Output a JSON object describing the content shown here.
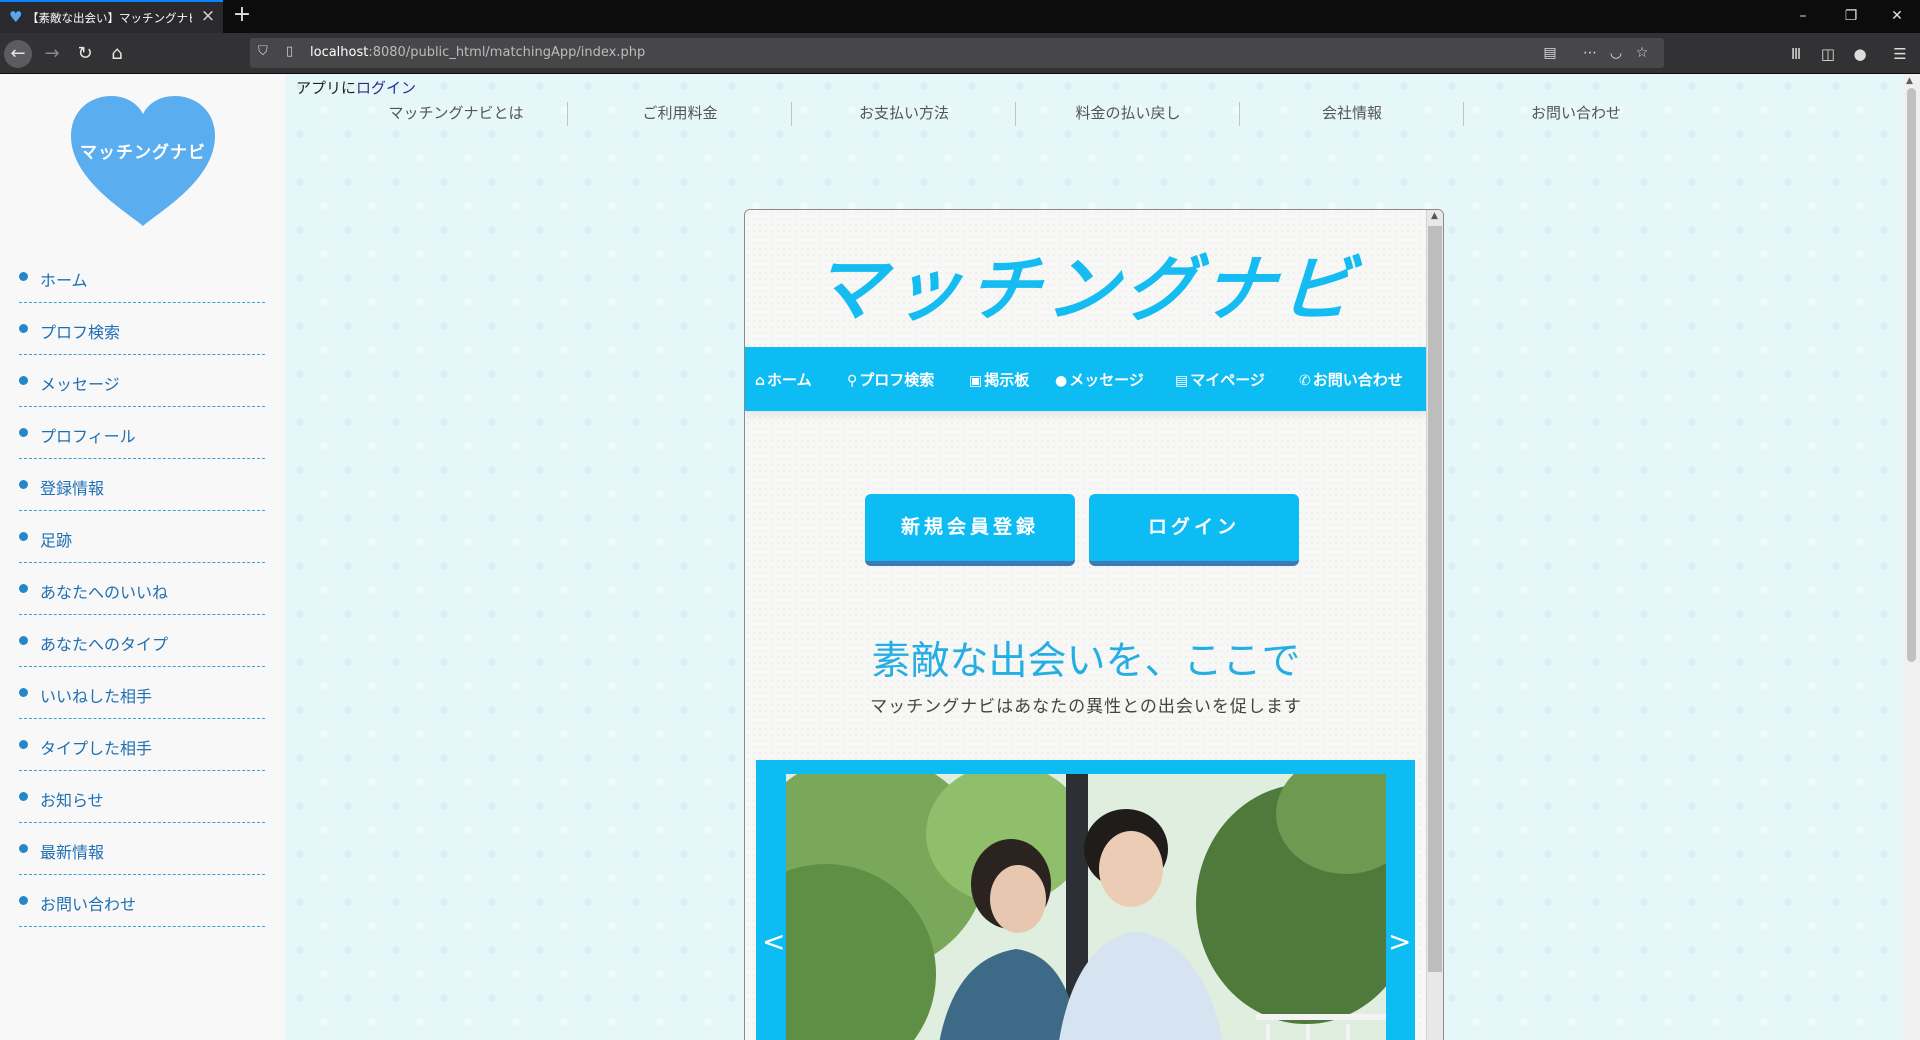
{
  "browser": {
    "tab_title": "【素敵な出会い】マッチングナビ！",
    "url_host": "localhost",
    "url_path": ":8080/public_html/matchingApp/index.php",
    "window_controls": {
      "minimize": "–",
      "restore": "❐",
      "close": "✕"
    }
  },
  "sidebar": {
    "logo_text": "マッチングナビ",
    "logo_color": "#5aaef0",
    "items": [
      {
        "label": "ホーム"
      },
      {
        "label": "プロフ検索"
      },
      {
        "label": "メッセージ"
      },
      {
        "label": "プロフィール"
      },
      {
        "label": "登録情報"
      },
      {
        "label": "足跡"
      },
      {
        "label": "あなたへのいいね"
      },
      {
        "label": "あなたへのタイプ"
      },
      {
        "label": "いいねした相手"
      },
      {
        "label": "タイプした相手"
      },
      {
        "label": "お知らせ"
      },
      {
        "label": "最新情報"
      },
      {
        "label": "お問い合わせ"
      }
    ]
  },
  "top": {
    "login_prefix": "アプリに",
    "login_link": "ログイン",
    "nav": [
      "マッチングナビとは",
      "ご利用料金",
      "お支払い方法",
      "料金の払い戻し",
      "会社情報",
      "お問い合わせ"
    ]
  },
  "app": {
    "title": "マッチングナビ",
    "accent": "#0dbcf3",
    "nav": [
      {
        "icon": "home-icon",
        "label": "ホーム"
      },
      {
        "icon": "search-icon",
        "label": "プロフ検索"
      },
      {
        "icon": "clipboard-icon",
        "label": "掲示板"
      },
      {
        "icon": "chat-icon",
        "label": "メッセージ"
      },
      {
        "icon": "id-card-icon",
        "label": "マイページ"
      },
      {
        "icon": "phone-icon",
        "label": "お問い合わせ"
      }
    ],
    "register_button": "新規会員登録",
    "login_button": "ログイン",
    "headline": "素敵な出会いを、ここで",
    "subline": "マッチングナビはあなたの異性との出会いを促します",
    "slider": {
      "prev": "<",
      "next": ">"
    }
  }
}
